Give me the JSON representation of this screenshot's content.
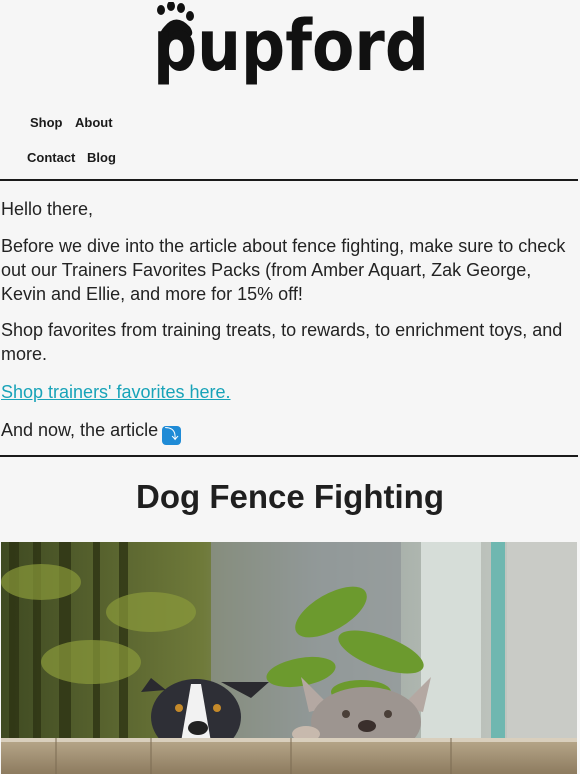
{
  "brand": {
    "logo_text": "pupford"
  },
  "nav": {
    "items": [
      {
        "label": "Shop"
      },
      {
        "label": "About"
      },
      {
        "label": "Contact"
      },
      {
        "label": "Blog"
      }
    ]
  },
  "intro": {
    "greeting": "Hello there,",
    "paragraph1": "Before we dive into the article about fence fighting, make sure to check out our Trainers Favorites Packs (from Amber Aquart, Zak George, Kevin and Ellie, and more for 15% off!",
    "paragraph2": "Shop favorites from training treats, to rewards, to enrichment toys, and more.",
    "cta_link": "Shop trainers' favorites here.",
    "transition_text": "And now, the article",
    "transition_emoji": "⤵"
  },
  "article": {
    "title": "Dog Fence Fighting",
    "hero_image": {
      "subject": "two dogs peeking over a wooden fence",
      "icon": "hero-photo"
    }
  },
  "colors": {
    "background": "#f6f6f6",
    "text": "#232323",
    "link": "#18a3b8",
    "rule": "#1a1a1a",
    "emoji_bg": "#1f8bd6"
  }
}
